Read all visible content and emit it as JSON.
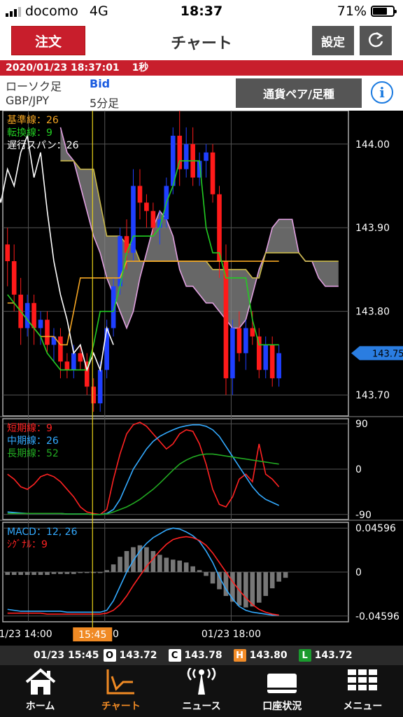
{
  "status_bar": {
    "carrier": "docomo",
    "network": "4G",
    "time": "18:37",
    "battery": "71%",
    "battery_level": 0.71
  },
  "nav": {
    "order_label": "注文",
    "title": "チャート",
    "settings_label": "設定",
    "refresh_icon": "refresh-icon"
  },
  "date_bar": {
    "datetime": "2020/01/23 18:37:01",
    "interval": "1秒"
  },
  "info": {
    "chart_type_label": "ローソク足",
    "price_type": "Bid",
    "pair": "GBP/JPY",
    "timeframe": "5分足",
    "pair_button_label": "通貨ペア/足種",
    "info_icon": "i"
  },
  "chart_data": [
    {
      "type": "candlestick",
      "panel": "price",
      "indicator": "ichimoku",
      "legend": [
        {
          "label": "基準線：26",
          "color": "#f5a623"
        },
        {
          "label": "転換線：9",
          "color": "#22cc22"
        },
        {
          "label": "遅行スパン：26",
          "color": "#ffffff"
        }
      ],
      "y_ticks": [
        "144.00",
        "143.90",
        "143.80",
        "143.70"
      ],
      "ylim": [
        143.675,
        144.04
      ],
      "current_price": "143.75",
      "current_price_value": 143.75,
      "x_ticks": [
        "1/23 14:00",
        "16:00",
        "01/23 18:00"
      ],
      "crosshair_time": "15:45",
      "colors": {
        "up": "#1f3fff",
        "down": "#ff1a1a",
        "cloud": "#8a8a8a",
        "span_a": "#e0a0e0",
        "span_b": "#c9b84a"
      },
      "candles": [
        {
          "o": 143.88,
          "h": 143.9,
          "l": 143.83,
          "c": 143.86
        },
        {
          "o": 143.86,
          "h": 143.88,
          "l": 143.8,
          "c": 143.82
        },
        {
          "o": 143.82,
          "h": 143.84,
          "l": 143.76,
          "c": 143.78
        },
        {
          "o": 143.78,
          "h": 143.82,
          "l": 143.77,
          "c": 143.81
        },
        {
          "o": 143.81,
          "h": 143.82,
          "l": 143.76,
          "c": 143.78
        },
        {
          "o": 143.78,
          "h": 143.8,
          "l": 143.76,
          "c": 143.79
        },
        {
          "o": 143.79,
          "h": 143.8,
          "l": 143.75,
          "c": 143.76
        },
        {
          "o": 143.76,
          "h": 143.78,
          "l": 143.74,
          "c": 143.77
        },
        {
          "o": 143.77,
          "h": 143.78,
          "l": 143.72,
          "c": 143.74
        },
        {
          "o": 143.74,
          "h": 143.75,
          "l": 143.72,
          "c": 143.73
        },
        {
          "o": 143.73,
          "h": 143.76,
          "l": 143.72,
          "c": 143.75
        },
        {
          "o": 143.75,
          "h": 143.76,
          "l": 143.73,
          "c": 143.74
        },
        {
          "o": 143.74,
          "h": 143.75,
          "l": 143.7,
          "c": 143.71
        },
        {
          "o": 143.71,
          "h": 143.72,
          "l": 143.68,
          "c": 143.69
        },
        {
          "o": 143.69,
          "h": 143.74,
          "l": 143.68,
          "c": 143.73
        },
        {
          "o": 143.73,
          "h": 143.79,
          "l": 143.72,
          "c": 143.78
        },
        {
          "o": 143.78,
          "h": 143.84,
          "l": 143.77,
          "c": 143.83
        },
        {
          "o": 143.83,
          "h": 143.9,
          "l": 143.82,
          "c": 143.89
        },
        {
          "o": 143.89,
          "h": 143.91,
          "l": 143.85,
          "c": 143.87
        },
        {
          "o": 143.87,
          "h": 143.97,
          "l": 143.86,
          "c": 143.95
        },
        {
          "o": 143.95,
          "h": 143.97,
          "l": 143.91,
          "c": 143.93
        },
        {
          "o": 143.93,
          "h": 143.94,
          "l": 143.9,
          "c": 143.92
        },
        {
          "o": 143.92,
          "h": 143.93,
          "l": 143.89,
          "c": 143.9
        },
        {
          "o": 143.9,
          "h": 143.92,
          "l": 143.88,
          "c": 143.91
        },
        {
          "o": 143.91,
          "h": 143.96,
          "l": 143.9,
          "c": 143.95
        },
        {
          "o": 143.95,
          "h": 144.02,
          "l": 143.94,
          "c": 144.01
        },
        {
          "o": 144.01,
          "h": 144.04,
          "l": 143.95,
          "c": 143.97
        },
        {
          "o": 143.97,
          "h": 144.02,
          "l": 143.96,
          "c": 144.0
        },
        {
          "o": 144.0,
          "h": 144.02,
          "l": 143.95,
          "c": 143.96
        },
        {
          "o": 143.96,
          "h": 143.99,
          "l": 143.95,
          "c": 143.98
        },
        {
          "o": 143.98,
          "h": 144.0,
          "l": 143.96,
          "c": 143.99
        },
        {
          "o": 143.99,
          "h": 144.0,
          "l": 143.93,
          "c": 143.94
        },
        {
          "o": 143.94,
          "h": 143.95,
          "l": 143.84,
          "c": 143.86
        },
        {
          "o": 143.86,
          "h": 143.88,
          "l": 143.7,
          "c": 143.72
        },
        {
          "o": 143.72,
          "h": 143.79,
          "l": 143.7,
          "c": 143.78
        },
        {
          "o": 143.78,
          "h": 143.8,
          "l": 143.74,
          "c": 143.75
        },
        {
          "o": 143.75,
          "h": 143.79,
          "l": 143.73,
          "c": 143.78
        },
        {
          "o": 143.78,
          "h": 143.8,
          "l": 143.76,
          "c": 143.77
        },
        {
          "o": 143.77,
          "h": 143.78,
          "l": 143.72,
          "c": 143.73
        },
        {
          "o": 143.73,
          "h": 143.77,
          "l": 143.72,
          "c": 143.76
        },
        {
          "o": 143.76,
          "h": 143.77,
          "l": 143.71,
          "c": 143.72
        },
        {
          "o": 143.72,
          "h": 143.76,
          "l": 143.71,
          "c": 143.75
        }
      ],
      "kijun": [
        143.81,
        143.81,
        143.8,
        143.79,
        143.78,
        143.77,
        143.77,
        143.77,
        143.76,
        143.76,
        143.8,
        143.84,
        143.84,
        143.84,
        143.84,
        143.84,
        143.84,
        143.84,
        143.86,
        143.86,
        143.86,
        143.86,
        143.86,
        143.86,
        143.86,
        143.86,
        143.86,
        143.86,
        143.86,
        143.86,
        143.86,
        143.86,
        143.86,
        143.86,
        143.86,
        143.86,
        143.86,
        143.86,
        143.86,
        143.86,
        143.86,
        143.86
      ],
      "tenkan": [
        143.82,
        143.81,
        143.8,
        143.79,
        143.78,
        143.77,
        143.75,
        143.74,
        143.73,
        143.73,
        143.73,
        143.73,
        143.73,
        143.76,
        143.8,
        143.8,
        143.8,
        143.83,
        143.87,
        143.89,
        143.89,
        143.89,
        143.89,
        143.9,
        143.93,
        143.95,
        143.98,
        143.98,
        143.98,
        143.98,
        143.9,
        143.87,
        143.87,
        143.84,
        143.84,
        143.84,
        143.84,
        143.79,
        143.76,
        143.76,
        143.76,
        143.76
      ],
      "chikou": [
        143.88,
        143.92,
        143.96,
        143.93,
        143.97,
        143.95,
        143.99,
        144.01,
        143.96,
        143.99,
        143.92,
        143.86,
        143.82,
        143.79,
        143.75,
        143.76,
        143.73,
        143.75,
        143.73,
        143.78,
        143.76
      ],
      "span_a": [
        144.02,
        143.99,
        143.98,
        143.95,
        143.92,
        143.89,
        143.87,
        143.84,
        143.82,
        143.8,
        143.78,
        143.8,
        143.84,
        143.87,
        143.9,
        143.92,
        143.91,
        143.89,
        143.85,
        143.83,
        143.83,
        143.82,
        143.81,
        143.81,
        143.8,
        143.79,
        143.78,
        143.78,
        143.79,
        143.82,
        143.85,
        143.87,
        143.9,
        143.91,
        143.91,
        143.91,
        143.87,
        143.86,
        143.86,
        143.84,
        143.83,
        143.83,
        143.83
      ],
      "span_b": [
        143.98,
        143.98,
        143.98,
        143.97,
        143.97,
        143.97,
        143.93,
        143.89,
        143.89,
        143.89,
        143.88,
        143.88,
        143.86,
        143.86,
        143.86,
        143.86,
        143.86,
        143.86,
        143.86,
        143.86,
        143.86,
        143.86,
        143.86,
        143.85,
        143.85,
        143.85,
        143.85,
        143.85,
        143.85,
        143.84,
        143.84,
        143.87,
        143.87,
        143.87,
        143.87,
        143.87,
        143.87,
        143.86,
        143.86,
        143.86,
        143.86,
        143.86,
        143.86
      ]
    },
    {
      "type": "line",
      "panel": "moving-average-deviation",
      "legend": [
        {
          "label": "短期線：9",
          "color": "#ff2222"
        },
        {
          "label": "中期線：26",
          "color": "#33aaff"
        },
        {
          "label": "長期線：52",
          "color": "#22aa22"
        }
      ],
      "y_ticks": [
        "90",
        "0",
        "-90"
      ],
      "ylim": [
        -100,
        100
      ],
      "series": [
        {
          "color": "#ff2222",
          "values": [
            -10,
            -20,
            -35,
            -40,
            -30,
            -15,
            -10,
            -15,
            -25,
            -40,
            -55,
            -75,
            -85,
            -88,
            -90,
            -80,
            -20,
            30,
            70,
            88,
            93,
            85,
            70,
            55,
            40,
            50,
            70,
            78,
            75,
            50,
            10,
            -40,
            -70,
            -75,
            -55,
            -20,
            -10,
            -25,
            50,
            -10,
            -20,
            -35
          ]
        },
        {
          "color": "#33aaff",
          "values": [
            -85,
            -86,
            -87,
            -88,
            -88,
            -88,
            -88,
            -88,
            -88,
            -89,
            -89,
            -89,
            -89,
            -90,
            -90,
            -88,
            -80,
            -60,
            -30,
            0,
            20,
            40,
            55,
            65,
            72,
            78,
            83,
            86,
            88,
            88,
            85,
            78,
            65,
            45,
            25,
            5,
            -15,
            -35,
            -50,
            -60,
            -66,
            -72
          ]
        },
        {
          "color": "#22aa22",
          "values": [
            -88,
            -88,
            -88,
            -88,
            -88,
            -88,
            -88,
            -88,
            -88,
            -89,
            -89,
            -89,
            -89,
            -90,
            -90,
            -89,
            -85,
            -80,
            -75,
            -68,
            -60,
            -50,
            -40,
            -28,
            -15,
            -2,
            10,
            18,
            24,
            28,
            30,
            30,
            28,
            26,
            24,
            22,
            20,
            18,
            16,
            14,
            12,
            10
          ]
        }
      ]
    },
    {
      "type": "bar",
      "panel": "macd",
      "legend": [
        {
          "label": "MACD：12, 26",
          "color": "#33aaff"
        },
        {
          "label": "ｼｸﾞﾅﾙ：9",
          "color": "#ff2222"
        }
      ],
      "y_ticks": [
        "0.04596",
        "0",
        "-0.04596"
      ],
      "ylim": [
        -0.052,
        0.052
      ],
      "histogram": [
        -0.003,
        -0.003,
        -0.003,
        -0.003,
        -0.003,
        -0.003,
        -0.003,
        -0.002,
        -0.002,
        -0.002,
        -0.002,
        -0.001,
        -0.001,
        -0.001,
        -0.001,
        0.002,
        0.008,
        0.016,
        0.022,
        0.026,
        0.028,
        0.026,
        0.022,
        0.018,
        0.015,
        0.013,
        0.012,
        0.01,
        0.006,
        0.002,
        -0.004,
        -0.012,
        -0.018,
        -0.025,
        -0.031,
        -0.035,
        -0.037,
        -0.036,
        -0.032,
        -0.025,
        -0.017,
        -0.01,
        -0.006
      ],
      "series": [
        {
          "color": "#33aaff",
          "values": [
            -0.039,
            -0.04,
            -0.041,
            -0.041,
            -0.041,
            -0.041,
            -0.041,
            -0.041,
            -0.041,
            -0.042,
            -0.042,
            -0.042,
            -0.042,
            -0.042,
            -0.042,
            -0.04,
            -0.03,
            -0.015,
            0.0,
            0.012,
            0.022,
            0.03,
            0.036,
            0.04,
            0.044,
            0.046,
            0.045,
            0.042,
            0.038,
            0.032,
            0.022,
            0.01,
            -0.005,
            -0.018,
            -0.028,
            -0.036,
            -0.04,
            -0.042,
            -0.043,
            -0.044,
            -0.045,
            -0.045
          ]
        },
        {
          "color": "#ff2222",
          "values": [
            -0.043,
            -0.043,
            -0.043,
            -0.043,
            -0.043,
            -0.043,
            -0.044,
            -0.044,
            -0.044,
            -0.044,
            -0.044,
            -0.044,
            -0.044,
            -0.044,
            -0.044,
            -0.043,
            -0.04,
            -0.034,
            -0.025,
            -0.014,
            -0.004,
            0.006,
            0.014,
            0.022,
            0.029,
            0.034,
            0.036,
            0.037,
            0.036,
            0.033,
            0.028,
            0.02,
            0.01,
            0.0,
            -0.01,
            -0.019,
            -0.027,
            -0.034,
            -0.039,
            -0.042,
            -0.044,
            -0.045
          ]
        }
      ]
    }
  ],
  "ohlc": {
    "time": "01/23 15:45",
    "items": [
      {
        "label": "O",
        "value": "143.72"
      },
      {
        "label": "C",
        "value": "143.78"
      },
      {
        "label": "H",
        "value": "143.80"
      },
      {
        "label": "L",
        "value": "143.72"
      }
    ]
  },
  "tabs": [
    {
      "label": "ホーム",
      "icon": "home-icon",
      "active": false
    },
    {
      "label": "チャート",
      "icon": "chart-icon",
      "active": true
    },
    {
      "label": "ニュース",
      "icon": "news-icon",
      "active": false
    },
    {
      "label": "口座状況",
      "icon": "account-icon",
      "active": false
    },
    {
      "label": "メニュー",
      "icon": "menu-grid-icon",
      "active": false
    }
  ]
}
